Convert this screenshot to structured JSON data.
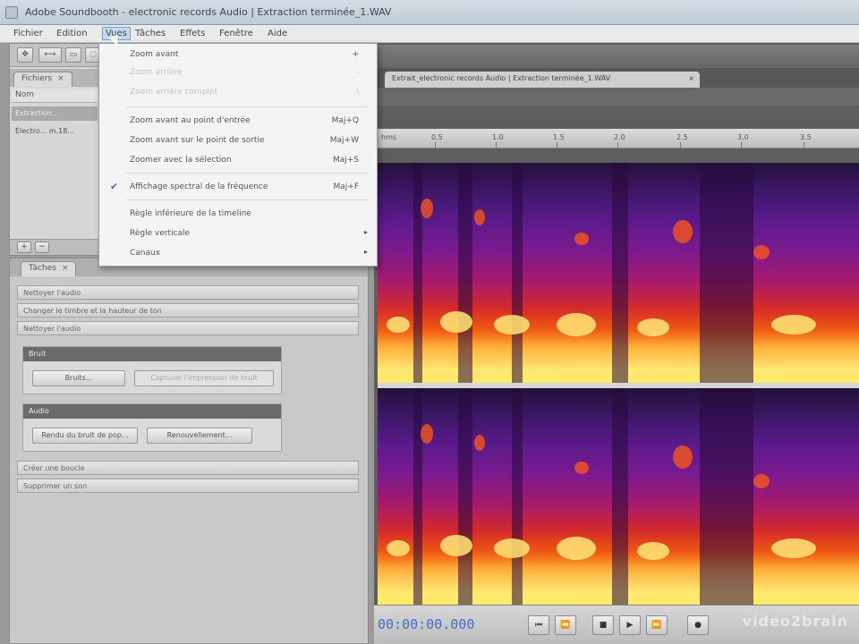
{
  "window": {
    "title": "Adobe Soundbooth - electronic records Audio | Extraction terminée_1.WAV"
  },
  "menubar": {
    "items": [
      "Fichier",
      "Edition",
      "Vues",
      "Tâches",
      "Effets",
      "Fenêtre",
      "Aide"
    ]
  },
  "files_panel": {
    "tab_label": "Fichiers",
    "column_header": "Nom",
    "rows": [
      "Extraction...",
      "Électro... m.18..."
    ]
  },
  "tasks_panel": {
    "tab_label": "Tâches",
    "sections": [
      "Nettoyer l'audio",
      "Changer le timbre et la hauteur de ton",
      "Nettoyer l'audio",
      "Créer une boucle",
      "Supprimer un son"
    ],
    "group_bruit": {
      "header": "Bruit",
      "buttons": [
        "Bruits...",
        "Capturer l'impression de bruit"
      ]
    },
    "group_audio": {
      "header": "Audio",
      "buttons": [
        "Rendu du bruit de pop...",
        "Renouvellement..."
      ]
    }
  },
  "editor": {
    "doc_tab_label": "Extrait_electronic records Audio | Extraction terminée_1.WAV",
    "ruler_labels": [
      "hms",
      "0.5",
      "1.0",
      "1.5",
      "2.0",
      "2.5",
      "3.0",
      "3.5"
    ],
    "timecode": "00:00:00.000",
    "watermark": "video2brain"
  },
  "view_menu": {
    "items": [
      {
        "label": "Zoom avant",
        "shortcut": "+",
        "disabled": false,
        "checked": false,
        "submenu": false
      },
      {
        "label": "Zoom arrière",
        "shortcut": "-",
        "disabled": true,
        "checked": false,
        "submenu": false
      },
      {
        "label": "Zoom arrière complet",
        "shortcut": "\\",
        "disabled": true,
        "checked": false,
        "submenu": false
      },
      {
        "label": "Zoom avant au point d'entrée",
        "shortcut": "Maj+Q",
        "disabled": false,
        "checked": false,
        "submenu": false
      },
      {
        "label": "Zoom avant sur le point de sortie",
        "shortcut": "Maj+W",
        "disabled": false,
        "checked": false,
        "submenu": false
      },
      {
        "label": "Zoomer avec la sélection",
        "shortcut": "Maj+S",
        "disabled": false,
        "checked": false,
        "submenu": false
      },
      {
        "label": "Affichage spectral de la fréquence",
        "shortcut": "Maj+F",
        "disabled": false,
        "checked": true,
        "submenu": false
      },
      {
        "label": "Règle inférieure de la timeline",
        "shortcut": "",
        "disabled": false,
        "checked": false,
        "submenu": false
      },
      {
        "label": "Règle verticale",
        "shortcut": "",
        "disabled": false,
        "checked": false,
        "submenu": true
      },
      {
        "label": "Canaux",
        "shortcut": "",
        "disabled": false,
        "checked": false,
        "submenu": true
      }
    ]
  }
}
